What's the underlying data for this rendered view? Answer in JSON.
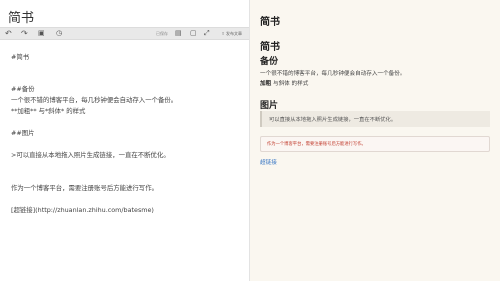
{
  "editor": {
    "title": "简书",
    "toolbar": {
      "undo_icon": "undo-icon",
      "redo_icon": "redo-icon",
      "image_icon": "image-icon",
      "clock_icon": "clock-icon",
      "status_text": "已保存",
      "save_icon": "save-icon",
      "preview_icon": "preview-icon",
      "split_icon": "split-icon",
      "fullscreen_icon": "fullscreen-icon",
      "publish_label": "发布文章"
    },
    "lines": [
      "#简书",
      "##备份",
      "一个很不错的博客平台，每几秒钟便会自动存入一个备份。",
      "**加粗**  与*斜体* 的样式",
      "##图片",
      ">可以直接从本地拖入照片生成链接，一直在不断优化。",
      "    作为一个博客平台，需要注册账号后方能进行写作。",
      "[超链接](http://zhuanlan.zhihu.com/batesme)"
    ]
  },
  "preview": {
    "title": "简书",
    "h1": "简书",
    "backup_heading": "备份",
    "backup_text": "一个很不错的博客平台，每几秒钟便会自动存入一个备份。",
    "bold_text": "加粗",
    "italic_text": " 与斜体 的样式",
    "image_heading": "图片",
    "quote_text": "可以直接从本地拖入照片生成链接，一直在不断优化。",
    "code_text": "作为一个博客平台，需要注册账号后方能进行写作。",
    "link_text": "超链接"
  }
}
